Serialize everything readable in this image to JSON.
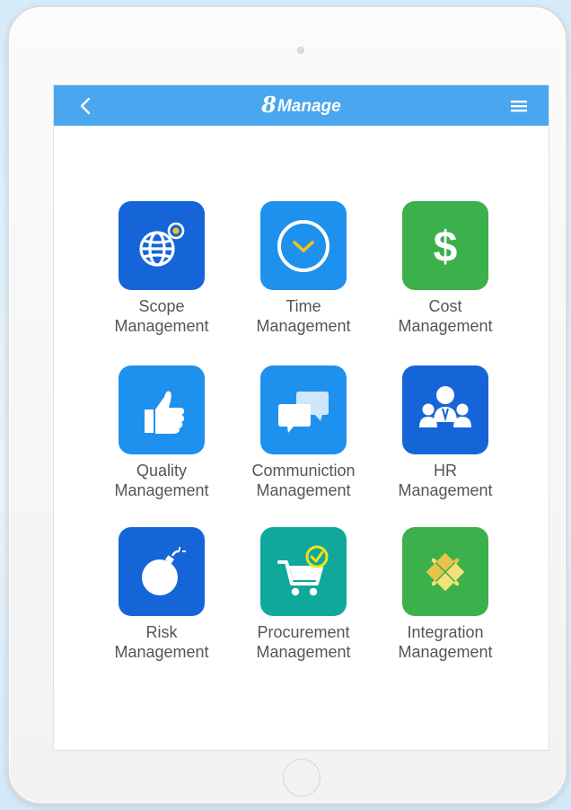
{
  "header": {
    "brand_number": "8",
    "brand_name": "Manage",
    "background": "#4aa6ee"
  },
  "modules": [
    {
      "line1": "Scope",
      "line2": "Management",
      "icon": "globe-pin-icon",
      "color": "#1565d8"
    },
    {
      "line1": "Time",
      "line2": "Management",
      "icon": "clock-icon",
      "color": "#1e90ee"
    },
    {
      "line1": "Cost",
      "line2": "Management",
      "icon": "dollar-icon",
      "color": "#3cb04a"
    },
    {
      "line1": "Quality",
      "line2": "Management",
      "icon": "thumbs-up-icon",
      "color": "#1e90ee"
    },
    {
      "line1": "Communiction",
      "line2": "Management",
      "icon": "chat-bubbles-icon",
      "color": "#1e90ee"
    },
    {
      "line1": "HR",
      "line2": "Management",
      "icon": "team-icon",
      "color": "#1565d8"
    },
    {
      "line1": "Risk",
      "line2": "Management",
      "icon": "bomb-icon",
      "color": "#1565d8"
    },
    {
      "line1": "Procurement",
      "line2": "Management",
      "icon": "cart-check-icon",
      "color": "#0fa89a"
    },
    {
      "line1": "Integration",
      "line2": "Management",
      "icon": "puzzle-icon",
      "color": "#3cb04a"
    }
  ]
}
